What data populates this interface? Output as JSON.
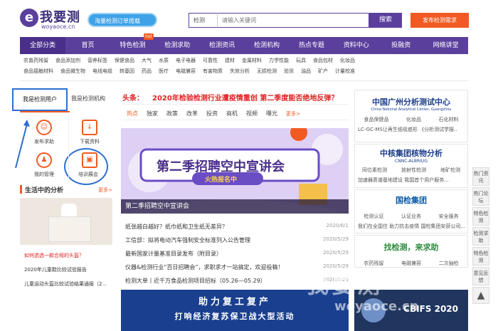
{
  "header": {
    "logo_cn": "我要测",
    "logo_en": "woyaoce.cn",
    "promo": "海量检测订单揽载",
    "search_select": "检测",
    "search_placeholder": "请输入关键词",
    "search_button": "搜索",
    "post_button": "发布检测需求"
  },
  "nav": {
    "all": "全部分类",
    "items": [
      "首页",
      "特色检测",
      "检测求助",
      "检测资讯",
      "检测机构",
      "热点专题",
      "资料中心",
      "投融资",
      "网络讲堂"
    ],
    "hot": "hot"
  },
  "categories": {
    "row1": [
      "农兽药残留",
      "食品添加剂",
      "营养标签",
      "保健食品",
      "大气",
      "水质",
      "电子电器",
      "可靠性",
      "建材",
      "金属材料",
      "力学性能",
      "玩具",
      "食品包材",
      "化妆品"
    ],
    "row2": [
      "食品接触材料",
      "食品微生物",
      "电线电缆",
      "转基因",
      "药品",
      "医疗",
      "电磁兼容",
      "有害物质",
      "失效分析",
      "无损检测",
      "验货",
      "油品",
      "矿产",
      "计量校准"
    ]
  },
  "left": {
    "user_tab": "我是检测用户",
    "org_tab": "我是检测机构",
    "icons": [
      "发布求助",
      "下载资料",
      "我的管理",
      "培训展会"
    ],
    "life_title": "生活中的分析",
    "more": "更多>",
    "links": [
      "如何选选一款合规的头盔？",
      "2020年儿童鞋比较试验报告",
      "儿童运动头盔比较试验结果通报（2..."
    ]
  },
  "middle": {
    "tag": "头条：",
    "headline": "2020年检验检测行业遭疫情重创 第二季度能否绝地反弹？",
    "tabs": [
      "热点",
      "独家",
      "政策",
      "政策",
      "改革",
      "投资",
      "商机",
      "视频",
      "曝光"
    ],
    "tab_more": "更多>",
    "banner_title": "第二季招聘空中宣讲会",
    "banner_sub": "火热报名中",
    "banner_caption": "第二季招聘空中宣讲会",
    "news": [
      {
        "t": "纸张越白越好？纸巾纸和卫生纸无差异？",
        "d": "2020/6/1"
      },
      {
        "t": "工信部：拟将电动汽车强制安全标准列入公告管理",
        "d": "2020/5/29"
      },
      {
        "t": "最新国家计量基准目录发布（附目录）",
        "d": "2020/5/29"
      },
      {
        "t": "仪器&检测行业“百日招聘会”，求职求才一站搞定，欢迎投稿！",
        "d": "2020/5/29"
      },
      {
        "t": "检测大单丨近千万食品检测项目招标（05.26—05.29）",
        "d": "2020/5/29"
      }
    ],
    "bottom_banner": [
      "助力复工复产",
      "打响经济复苏保卫战大型活动"
    ]
  },
  "right": {
    "p1": "中国广州分析测试中心",
    "p1_en": "China National Analytical Center, Guangzhou",
    "p1_tags": [
      "食品保健品",
      "化妆品",
      "石化材料"
    ],
    "p1_links": "LC-GC-MS让再生纸吸惑形  《分析测试学报..",
    "p2": "中核集团核物分析",
    "p2_en": "CNNC-ALBRIUG",
    "p2_tags": [
      "同位素检测",
      "放射性检测",
      "地矿检测"
    ],
    "p2_links": "加速器质谱基地建设  我国首个用户服务...",
    "p3": "国检集团",
    "p3_tags": [
      "检测认证",
      "认证业务",
      "安全服务"
    ],
    "p3_links": "我们在全国住  助力抗击疫情  国检集团安获公司...",
    "p4": "找检测，来求助",
    "p4_tags": [
      "农药残留",
      "电磁兼容",
      "二次抽检"
    ],
    "cbifs": "CBIFS 2020",
    "side": [
      "热门资讯",
      "热门论坛",
      "特色检测",
      "检测求助",
      "特色检测",
      "意见反馈"
    ],
    "watermark": "我要测",
    "watermark_en": "woyaoce.cn"
  }
}
